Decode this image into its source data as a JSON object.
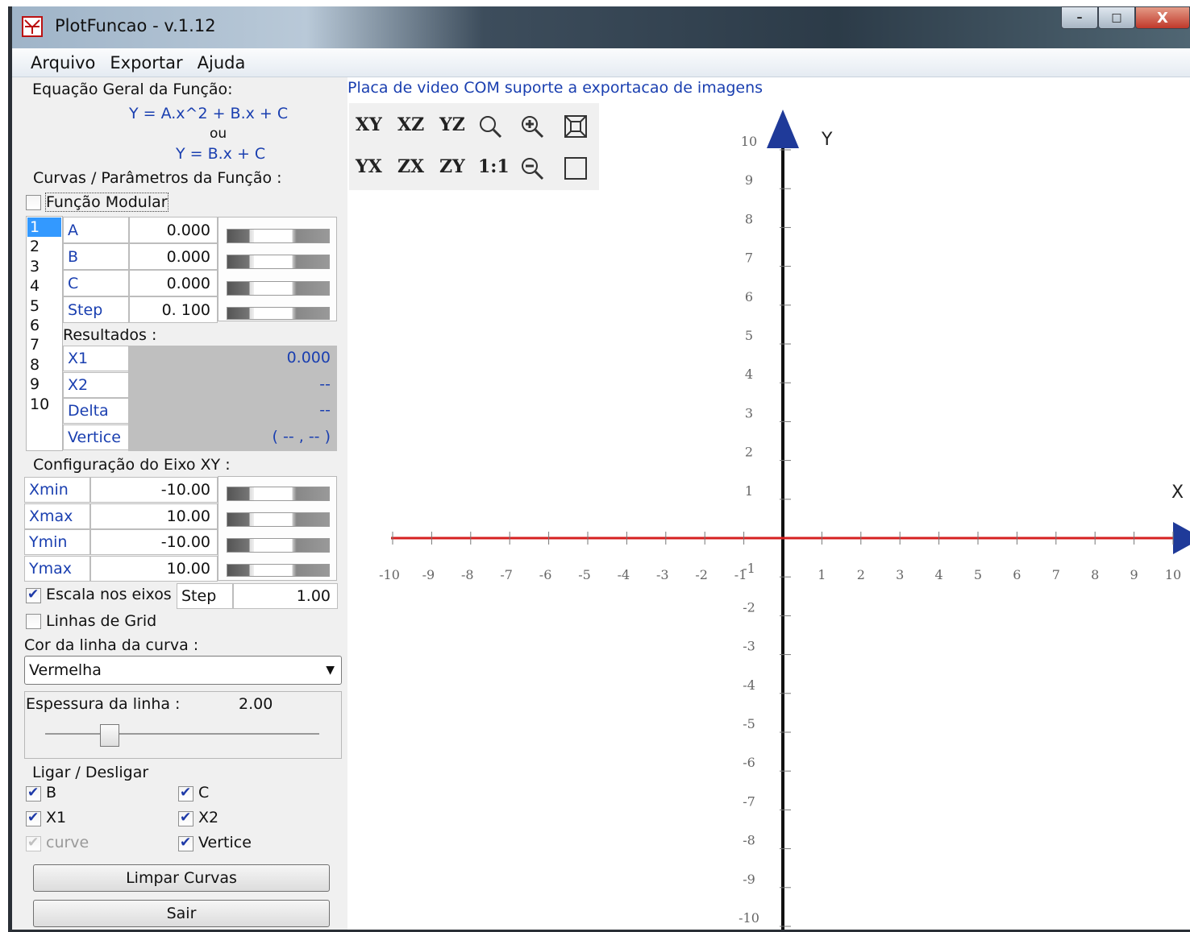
{
  "window": {
    "title": "PlotFuncao - v.1.12",
    "minimize": "–",
    "maximize": "□",
    "close": "X"
  },
  "menu": [
    "Arquivo",
    "Exportar",
    "Ajuda"
  ],
  "equation": {
    "heading": "Equação Geral da Função:",
    "line1": "Y = A.x^2 + B.x + C",
    "or": "ou",
    "line2": "Y = B.x + C"
  },
  "curves": {
    "heading": "Curvas / Parâmetros da Função :",
    "modular_label": "Função Modular",
    "modular_checked": false,
    "list": [
      "1",
      "2",
      "3",
      "4",
      "5",
      "6",
      "7",
      "8",
      "9",
      "10"
    ],
    "selected": "1",
    "params": [
      {
        "name": "A",
        "value": "0.000"
      },
      {
        "name": "B",
        "value": "0.000"
      },
      {
        "name": "C",
        "value": "0.000"
      },
      {
        "name": "Step",
        "value": "0. 100"
      }
    ],
    "results_heading": "Resultados :",
    "results": [
      {
        "name": "X1",
        "value": "0.000"
      },
      {
        "name": "X2",
        "value": "--"
      },
      {
        "name": "Delta",
        "value": "--"
      },
      {
        "name": "Vertice",
        "value": "( -- , -- )"
      }
    ]
  },
  "axis_config": {
    "heading": "Configuração do Eixo XY :",
    "rows": [
      {
        "name": "Xmin",
        "value": "-10.00"
      },
      {
        "name": "Xmax",
        "value": "10.00"
      },
      {
        "name": "Ymin",
        "value": "-10.00"
      },
      {
        "name": "Ymax",
        "value": "10.00"
      }
    ],
    "scale_label": "Escala nos eixos",
    "scale_checked": true,
    "step_label": "Step",
    "step_value": "1.00",
    "grid_label": "Linhas de Grid",
    "grid_checked": false
  },
  "line_color": {
    "label": "Cor da linha da curva :",
    "selected": "Vermelha"
  },
  "thickness": {
    "label": "Espessura da linha :",
    "value": "2.00"
  },
  "toggles": {
    "heading": "Ligar / Desligar",
    "items": [
      {
        "label": "B",
        "checked": true
      },
      {
        "label": "C",
        "checked": true
      },
      {
        "label": "X1",
        "checked": true
      },
      {
        "label": "X2",
        "checked": true
      },
      {
        "label": "curve",
        "checked": true
      },
      {
        "label": "Vertice",
        "checked": true
      }
    ]
  },
  "buttons": {
    "clear": "Limpar Curvas",
    "exit": "Sair"
  },
  "plot": {
    "notice": "Placa de video COM suporte a exportacao de imagens",
    "toolbar_row1": [
      "XY",
      "XZ",
      "YZ"
    ],
    "toolbar_row2": [
      "YX",
      "ZX",
      "ZY",
      "1:1"
    ],
    "x_axis_label": "X",
    "y_axis_label": "Y",
    "x_range": [
      -10,
      10
    ],
    "y_range": [
      -10,
      10
    ],
    "ticks": [
      "-10",
      "-9",
      "-8",
      "-7",
      "-6",
      "-5",
      "-4",
      "-3",
      "-2",
      "-1",
      "1",
      "2",
      "3",
      "4",
      "5",
      "6",
      "7",
      "8",
      "9",
      "10"
    ],
    "x_axis_color": "#d62020",
    "y_axis_color": "#111111",
    "arrow_color": "#1f3a99"
  }
}
